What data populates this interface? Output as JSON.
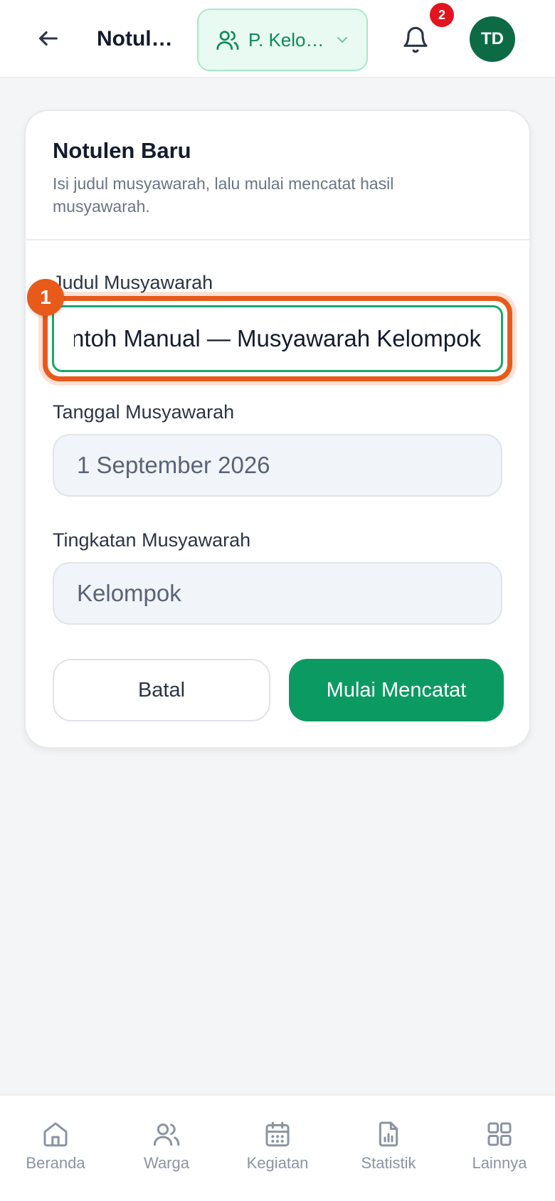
{
  "header": {
    "title": "Notulen Baru",
    "group_label": "P. Kelompok",
    "notification_count": "2",
    "avatar_initials": "TD"
  },
  "card": {
    "title": "Notulen Baru",
    "subtitle": "Isi judul musyawarah, lalu mulai mencatat hasil musyawarah.",
    "step_number": "1",
    "fields": {
      "judul_label": "Judul Musyawarah",
      "judul_value": "Contoh Manual — Musyawarah Kelompok",
      "tanggal_label": "Tanggal Musyawarah",
      "tanggal_value": "1 September 2026",
      "tingkatan_label": "Tingkatan Musyawarah",
      "tingkatan_value": "Kelompok"
    },
    "buttons": {
      "cancel": "Batal",
      "start": "Mulai Mencatat"
    }
  },
  "bottom_nav": {
    "items": [
      {
        "label": "Beranda",
        "icon": "home-icon"
      },
      {
        "label": "Warga",
        "icon": "users-icon"
      },
      {
        "label": "Kegiatan",
        "icon": "calendar-icon"
      },
      {
        "label": "Statistik",
        "icon": "chart-file-icon"
      },
      {
        "label": "Lainnya",
        "icon": "grid-icon"
      }
    ]
  },
  "colors": {
    "brand_green": "#0c9a63",
    "highlight_orange": "#e85a1a",
    "badge_red": "#e3131f"
  }
}
